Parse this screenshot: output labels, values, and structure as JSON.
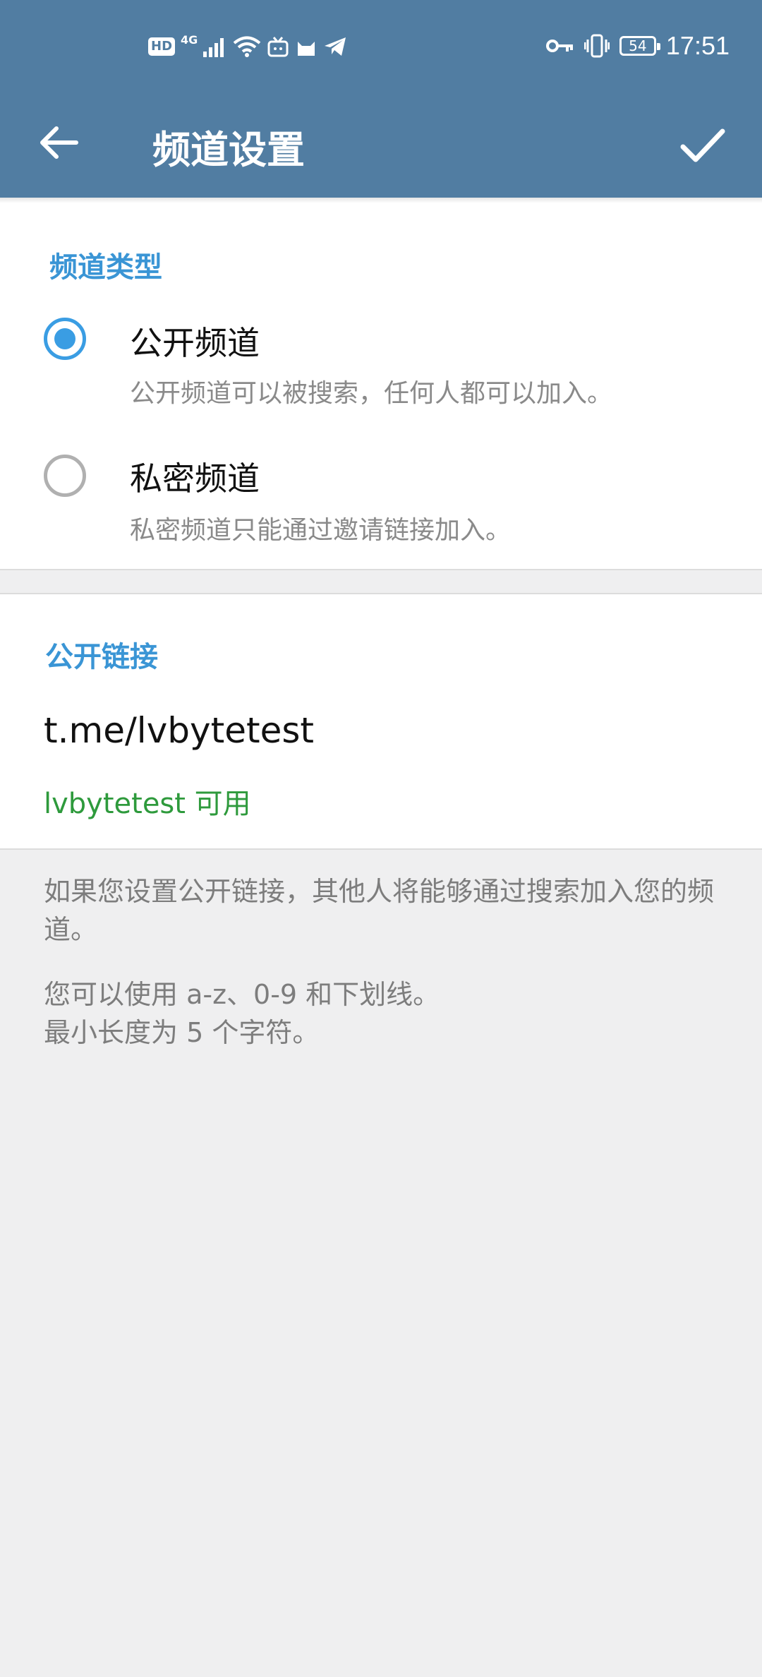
{
  "status_bar": {
    "hd": "HD",
    "network": "4G",
    "battery": "54",
    "time": "17:51"
  },
  "toolbar": {
    "title": "频道设置"
  },
  "channel_type": {
    "section_title": "频道类型",
    "options": [
      {
        "label": "公开频道",
        "description": "公开频道可以被搜索，任何人都可以加入。",
        "selected": true
      },
      {
        "label": "私密频道",
        "description": "私密频道只能通过邀请链接加入。",
        "selected": false
      }
    ]
  },
  "public_link": {
    "section_title": "公开链接",
    "value": "t.me/lvbytetest",
    "availability": "lvbytetest 可用"
  },
  "help": {
    "line1": "如果您设置公开链接，其他人将能够通过搜索加入您的频道。",
    "line2a": "您可以使用 a-z、0-9 和下划线。",
    "line2b": "最小长度为 5 个字符。"
  },
  "colors": {
    "header": "#517da2",
    "accent": "#3a9de3",
    "available": "#2e9a3c"
  }
}
